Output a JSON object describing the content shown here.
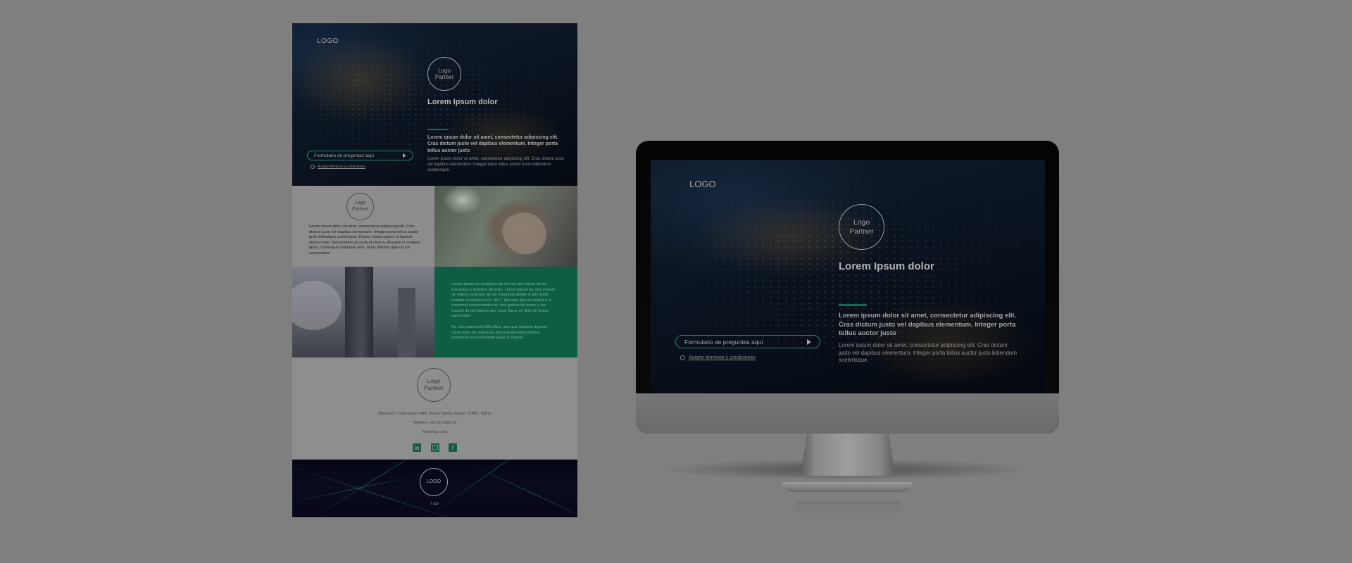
{
  "page_mockup": {
    "hero": {
      "logo": "LOGO",
      "partner_line1": "Logo",
      "partner_line2": "Partner",
      "title": "Lorem Ipsum dolor",
      "lead": "Lorem ipsum dolor sit amet, consectetur adipiscing elit. Cras dictum justo vel dapibus elementum. Integer porta tellus auctor justo",
      "body": "Lorem ipsum dolor sit amet, consectetur adipiscing elit. Cras dictum justo vel dapibus elementum. Integer porta tellus auctor justo bibendum scelerisque.",
      "form_label": "Formulario de preguntas aquí",
      "terms": "Acepto términos y condiciones"
    },
    "band2": {
      "partner_line1": "Logo",
      "partner_line2": "Partner",
      "text": "Lorem ipsum dolor sit amet, consectetur adipiscing elit. Cras dictum justo vel dapibus elementum. Integer porta tellus auctor justo bibendum scelerisque. Donec varius sapien ut laoreet ullamcorper. Sed pretium ac nulla et viverra. Aliquam in sodales lacus, consequat vulputate ante. Nunc lobortis quis orci ut consectetur."
    },
    "band3": {
      "p1": "Lorem Ipsum es simplemente el texto de relleno de las imprentas y archivos de texto. Lorem Ipsum ha sido el texto de relleno estándar de las industrias desde el año 1500, cuando un impresor (N. del T. persona que se dedica a la imprenta) desconocido usó una galería de textos y los mezcló de tal manera que logró hacer un libro de textos especimen.",
      "p2": "No sólo sobrevivió 500 años, sino que tambien ingresó como texto de relleno en documentos electrónicos, quedando esencialmente igual al original."
    },
    "band4": {
      "partner_line1": "Logo",
      "partner_line2": "Partner",
      "address": "Dirección: Lorem ipsum 444, Piso 4, Benito Juárez, CDMX, 03810",
      "phone": "Teléfono: +52 55 5555 55",
      "web": "www.logo.com",
      "social": [
        "in",
        "ig",
        "f"
      ]
    },
    "band5": {
      "logo": "LOGO",
      "footer": "Logo"
    }
  },
  "monitor": {
    "logo": "LOGO",
    "partner_line1": "Logo",
    "partner_line2": "Partner",
    "title": "Lorem Ipsum dolor",
    "lead": "Lorem ipsum dolor sit amet, consectetur adipiscing elit. Cras dictum justo vel dapibus elementum. Integer porta tellus auctor justo",
    "body": "Lorem ipsum dolor sit amet, consectetur adipiscing elit. Cras dictum justo vel dapibus elementum. Integer porta tellus auctor justo bibendum scelerisque.",
    "form_label": "Formulario de preguntas aquí",
    "terms": "Acepto términos y condiciones"
  },
  "colors": {
    "background": "#7f7f7f",
    "accent_green": "#0e5e43",
    "pill_border": "#24845f"
  },
  "icons": [
    "linkedin-icon",
    "instagram-icon",
    "facebook-icon",
    "play-icon",
    "radio-icon"
  ]
}
